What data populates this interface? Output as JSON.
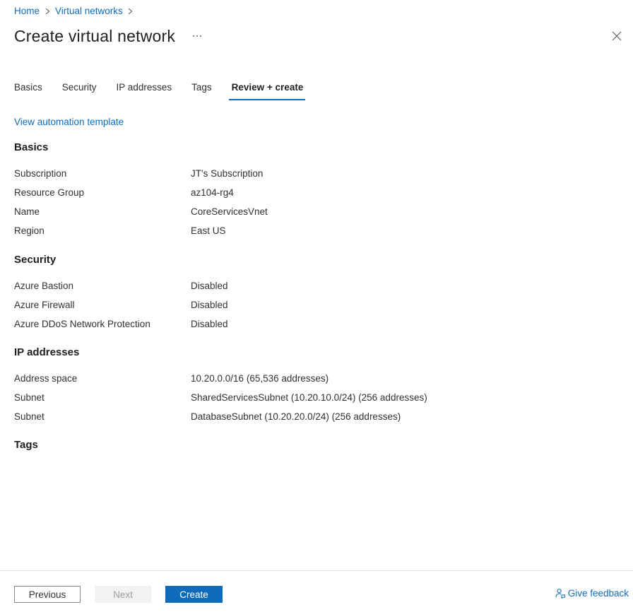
{
  "breadcrumb": {
    "items": [
      "Home",
      "Virtual networks"
    ]
  },
  "page": {
    "title": "Create virtual network",
    "more_icon": "ellipsis-icon",
    "close_icon": "close-icon"
  },
  "tabs": [
    {
      "label": "Basics",
      "active": false
    },
    {
      "label": "Security",
      "active": false
    },
    {
      "label": "IP addresses",
      "active": false
    },
    {
      "label": "Tags",
      "active": false
    },
    {
      "label": "Review + create",
      "active": true
    }
  ],
  "automation_link": "View automation template",
  "sections": {
    "basics": {
      "heading": "Basics",
      "rows": [
        {
          "label": "Subscription",
          "value": "JT's Subscription"
        },
        {
          "label": "Resource Group",
          "value": "az104-rg4"
        },
        {
          "label": "Name",
          "value": "CoreServicesVnet"
        },
        {
          "label": "Region",
          "value": "East US"
        }
      ]
    },
    "security": {
      "heading": "Security",
      "rows": [
        {
          "label": "Azure Bastion",
          "value": "Disabled"
        },
        {
          "label": "Azure Firewall",
          "value": "Disabled"
        },
        {
          "label": "Azure DDoS Network Protection",
          "value": "Disabled"
        }
      ]
    },
    "ip": {
      "heading": "IP addresses",
      "rows": [
        {
          "label": "Address space",
          "value": "10.20.0.0/16 (65,536 addresses)"
        },
        {
          "label": "Subnet",
          "value": "SharedServicesSubnet (10.20.10.0/24) (256 addresses)"
        },
        {
          "label": "Subnet",
          "value": "DatabaseSubnet (10.20.20.0/24) (256 addresses)"
        }
      ]
    },
    "tags": {
      "heading": "Tags"
    }
  },
  "footer": {
    "previous_label": "Previous",
    "next_label": "Next",
    "create_label": "Create",
    "feedback_label": "Give feedback",
    "feedback_icon": "feedback-icon"
  },
  "colors": {
    "accent": "#0f6cbd",
    "text": "#323130",
    "disabled_bg": "#f3f2f1",
    "disabled_text": "#a19f9d",
    "divider": "#e1dfdd"
  }
}
